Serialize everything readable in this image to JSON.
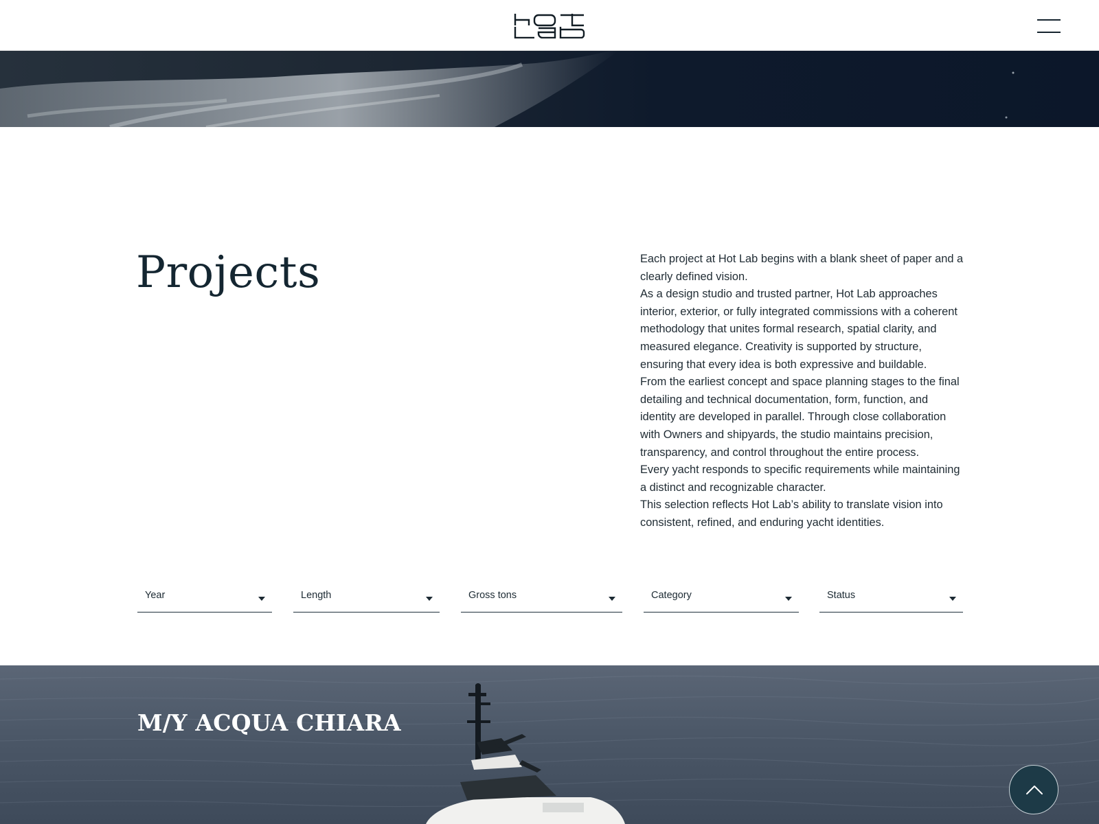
{
  "header": {
    "logo_text": "hot lab",
    "menu_icon": "hamburger-menu-icon"
  },
  "intro": {
    "title": "Projects",
    "paragraphs": [
      "Each project at Hot Lab begins with a blank sheet of paper and a clearly defined vision.",
      "As a design studio and trusted partner, Hot Lab approaches interior, exterior, or fully integrated commissions with a coherent methodology that unites formal research, spatial clarity, and measured elegance. Creativity is supported by structure, ensuring that every idea is both expressive and buildable.",
      "From the earliest concept and space planning stages to the final detailing and technical documentation, form, function, and identity are developed in parallel. Through close collaboration with Owners and shipyards, the studio maintains precision, transparency, and control throughout the entire process.",
      "Every yacht responds to specific requirements while maintaining a distinct and recognizable character.",
      "This selection reflects Hot Lab’s ability to translate vision into consistent, refined, and enduring yacht identities."
    ]
  },
  "filters": [
    {
      "label": "Year"
    },
    {
      "label": "Length"
    },
    {
      "label": "Gross tons"
    },
    {
      "label": "Category"
    },
    {
      "label": "Status"
    }
  ],
  "project": {
    "name": "M/Y ACQUA CHIARA"
  },
  "back_to_top": {
    "icon": "chevron-up-icon"
  },
  "colors": {
    "text_dark": "#142631",
    "accent_button": "#1d3a47",
    "background": "#ffffff"
  }
}
